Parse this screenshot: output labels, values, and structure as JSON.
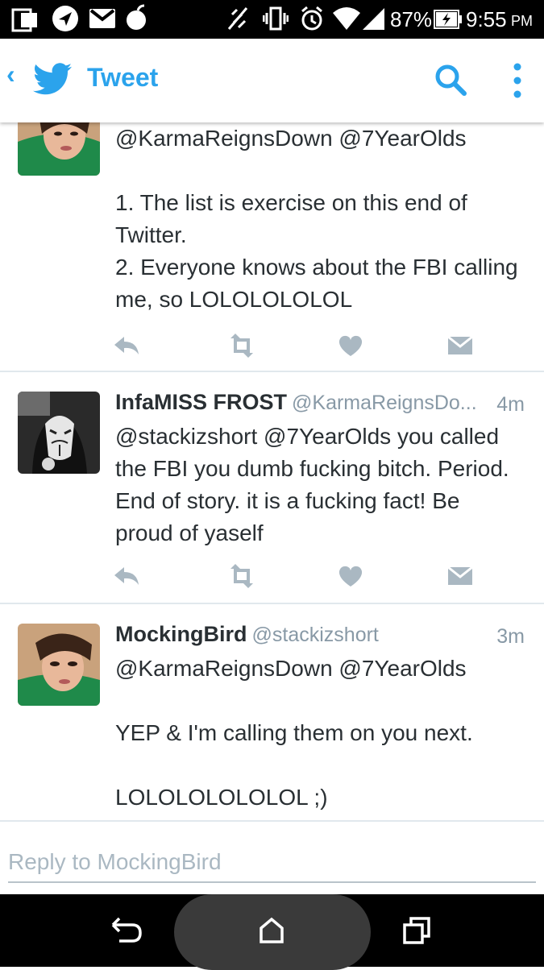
{
  "status_bar": {
    "battery": "87%",
    "time": "9:55",
    "ampm": "PM"
  },
  "app_bar": {
    "title": "Tweet",
    "icons": [
      "back-chevron-icon",
      "twitter-bird-icon",
      "search-icon",
      "overflow-menu-icon"
    ]
  },
  "tweets": [
    {
      "mentions": "@KarmaReignsDown @7YearOlds",
      "text": "1. The list is exercise on this end of Twitter.\n2. Everyone knows about the FBI calling me, so LOLOLOLOLOL"
    },
    {
      "name": "InfaMISS FROST",
      "handle": "@KarmaReignsDo...",
      "time": "4m",
      "text": "@stackizshort @7YearOlds you called the FBI you dumb fucking bitch. Period. End of story. it is a fucking fact! Be proud of yaself"
    },
    {
      "name": "MockingBird",
      "handle": "@stackizshort",
      "time": "3m",
      "mentions": "@KarmaReignsDown @7YearOlds",
      "text": "YEP & I'm calling them on you next.\n\nLOLOLOLOLOLOL ;)"
    }
  ],
  "tweet_actions": [
    "reply-icon",
    "retweet-icon",
    "like-icon",
    "direct-message-icon"
  ],
  "reply": {
    "placeholder": "Reply to MockingBird"
  },
  "nav_bar": {
    "icons": [
      "back-icon",
      "home-icon",
      "recents-icon"
    ]
  },
  "colors": {
    "accent": "#2ba3ec",
    "text": "#292f33",
    "secondary": "#8899a6",
    "action_icon": "#aab8c2",
    "divider": "#e1e8ed"
  }
}
